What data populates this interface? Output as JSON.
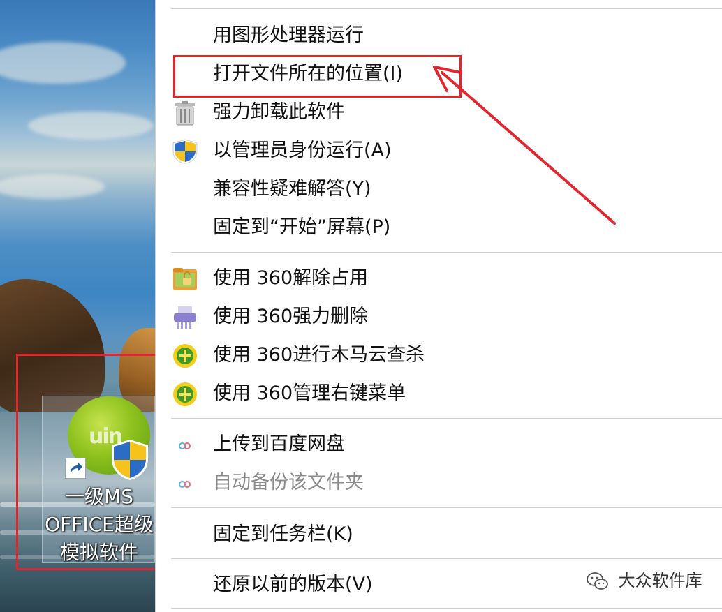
{
  "desktop": {
    "icon": {
      "name": "一级MS\nOFFICE超级\n模拟软件",
      "glyph": "uin"
    }
  },
  "context_menu": {
    "items": [
      {
        "label": "用图形处理器运行",
        "icon": ""
      },
      {
        "label": "打开文件所在的位置(I)",
        "icon": "",
        "highlighted": true
      },
      {
        "label": "强力卸载此软件",
        "icon": "trash-icon"
      },
      {
        "label": "以管理员身份运行(A)",
        "icon": "uac-shield-icon"
      },
      {
        "label": "兼容性疑难解答(Y)",
        "icon": ""
      },
      {
        "label": "固定到“开始”屏幕(P)",
        "icon": ""
      },
      {
        "label": "使用 360解除占用",
        "icon": "folder-lock-icon"
      },
      {
        "label": "使用 360强力删除",
        "icon": "shredder-icon"
      },
      {
        "label": "使用 360进行木马云查杀",
        "icon": "360-icon"
      },
      {
        "label": "使用 360管理右键菜单",
        "icon": "360-icon"
      },
      {
        "label": "上传到百度网盘",
        "icon": "baidu-cloud-icon"
      },
      {
        "label": "自动备份该文件夹",
        "icon": "baidu-cloud-icon",
        "disabled": true
      },
      {
        "label": "固定到任务栏(K)",
        "icon": ""
      },
      {
        "label": "还原以前的版本(V)",
        "icon": ""
      }
    ]
  },
  "watermark": {
    "text": "大众软件库",
    "icon": "wechat-icon"
  },
  "colors": {
    "highlight_red": "#e0262e",
    "menu_bg": "#ffffff",
    "disabled_text": "#8a8a8a"
  }
}
